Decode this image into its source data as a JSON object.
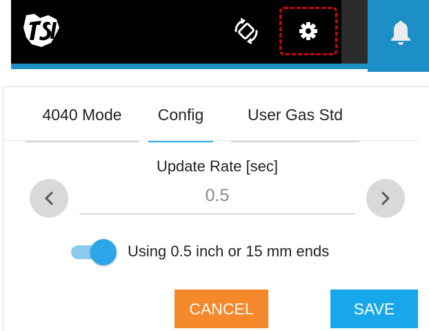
{
  "header": {
    "logo_icon": "tsi-logo-icon",
    "rotate_icon": "screen-rotate-icon",
    "settings_icon": "gear-icon",
    "notifications_icon": "bell-icon",
    "colors": {
      "bar": "#000000",
      "accent": "#1b8fc6",
      "highlight": "#e00000"
    }
  },
  "tabs": [
    {
      "label": "4040 Mode",
      "active": false
    },
    {
      "label": "Config",
      "active": true
    },
    {
      "label": "User Gas Std",
      "active": false
    }
  ],
  "update_rate": {
    "label": "Update Rate [sec]",
    "value": "0.5",
    "prev_icon": "chevron-left-icon",
    "next_icon": "chevron-right-icon"
  },
  "ends_toggle": {
    "label": "Using 0.5 inch or 15 mm ends",
    "on": true
  },
  "actions": {
    "cancel_label": "CANCEL",
    "save_label": "SAVE",
    "colors": {
      "cancel": "#f5882a",
      "save": "#17a7ea"
    }
  }
}
